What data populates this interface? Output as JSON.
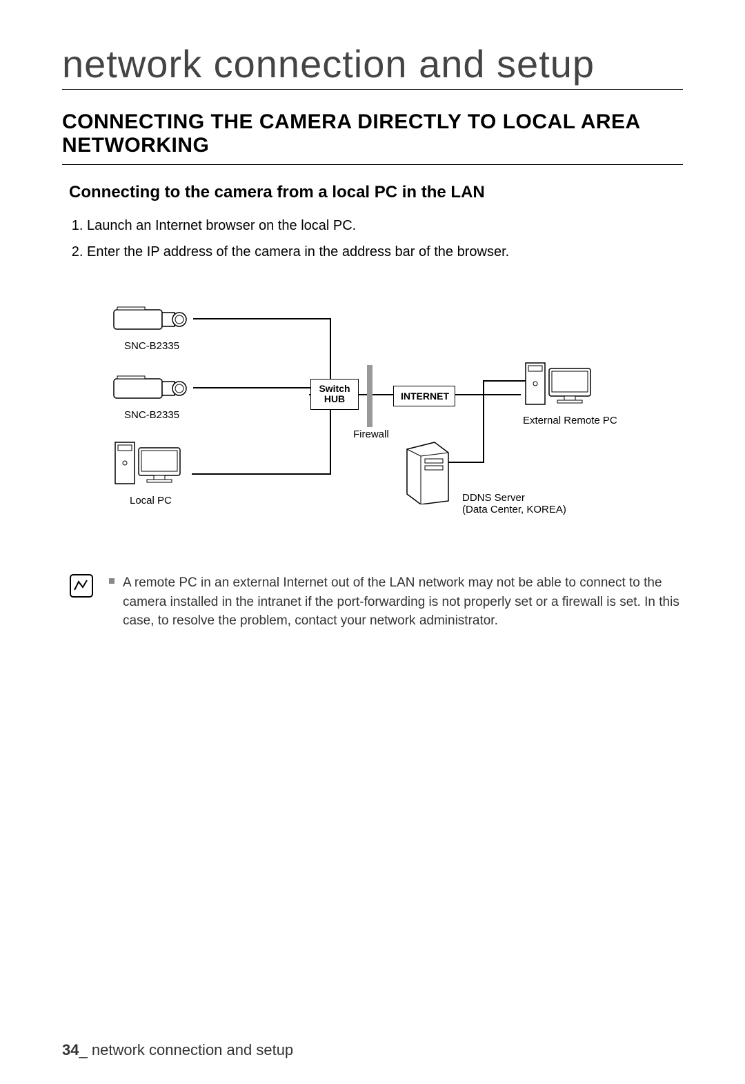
{
  "chapter_title": "network connection and setup",
  "section_title": "CONNECTING THE CAMERA DIRECTLY TO LOCAL AREA NETWORKING",
  "sub_title": "Connecting to the camera from a local PC in the LAN",
  "steps": [
    "Launch an Internet browser on the local PC.",
    "Enter the IP address of the camera in the address bar of the browser."
  ],
  "diagram": {
    "camera1_label": "SNC-B2335",
    "camera2_label": "SNC-B2335",
    "switch_label_line1": "Switch",
    "switch_label_line2": "HUB",
    "internet_label": "INTERNET",
    "firewall_label": "Firewall",
    "local_pc_label": "Local PC",
    "external_pc_label": "External Remote PC",
    "ddns_label_line1": "DDNS Server",
    "ddns_label_line2": "(Data Center, KOREA)"
  },
  "note_text": "A remote PC in an external Internet out of the LAN network may not be able to connect to the camera installed in the intranet if the port-forwarding is not properly set or a firewall is set. In this case, to resolve the problem, contact your network administrator.",
  "footer": {
    "page_number": "34",
    "separator": "_",
    "section": "network connection and setup"
  }
}
